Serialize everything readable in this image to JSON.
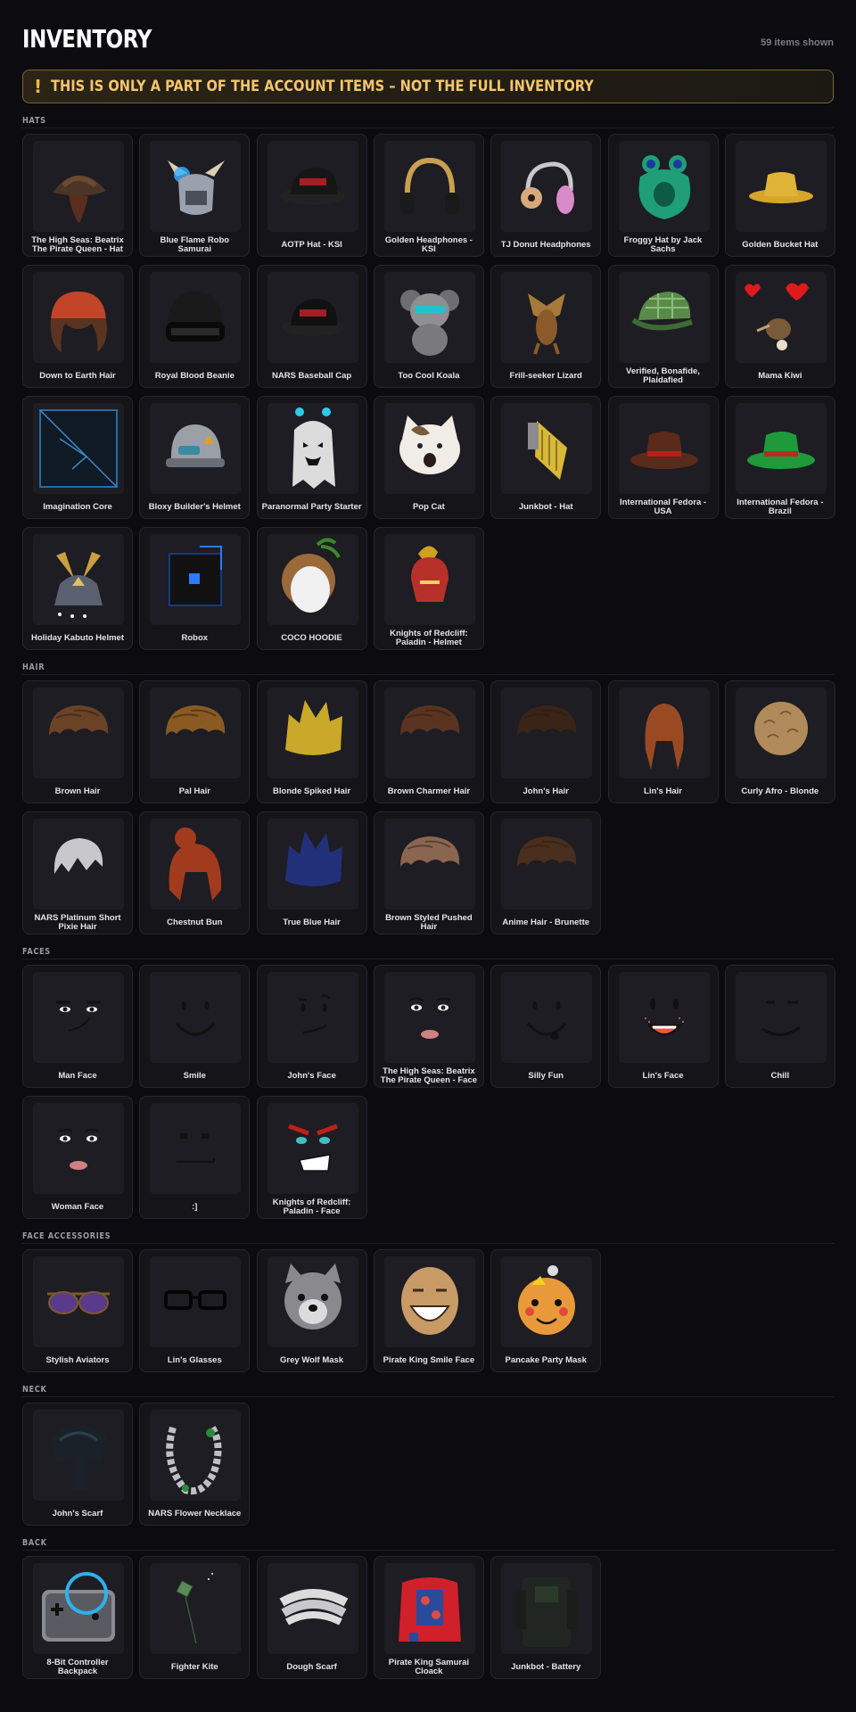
{
  "header": {
    "title": "INVENTORY",
    "items_count": "59 items shown"
  },
  "banner": {
    "icon": "!",
    "text": "THIS IS ONLY A PART OF THE ACCOUNT ITEMS – NOT THE FULL INVENTORY"
  },
  "sections": [
    {
      "label": "HATS",
      "items": [
        {
          "name": "The High Seas: Beatrix The Pirate Queen - Hat",
          "icon": "pirate-hat",
          "color": "#4a3526"
        },
        {
          "name": "Blue Flame Robo Samurai",
          "icon": "samurai-helmet",
          "color": "#9aa0ad"
        },
        {
          "name": "AOTP Hat - KSI",
          "icon": "cap",
          "color": "#161616"
        },
        {
          "name": "Golden Headphones - KSI",
          "icon": "headphones",
          "color": "#c8a050"
        },
        {
          "name": "TJ Donut Headphones",
          "icon": "donut-headphones",
          "color": "#d98ac8"
        },
        {
          "name": "Froggy Hat by Jack Sachs",
          "icon": "frog-hat",
          "color": "#1f9e77"
        },
        {
          "name": "Golden Bucket Hat",
          "icon": "bucket-hat",
          "color": "#d6a52a"
        },
        {
          "name": "Down to Earth Hair",
          "icon": "beanie-hair",
          "color": "#c2452a"
        },
        {
          "name": "Royal Blood Beanie",
          "icon": "beanie",
          "color": "#1a1a1a"
        },
        {
          "name": "NARS Baseball Cap",
          "icon": "cap",
          "color": "#111111"
        },
        {
          "name": "Too Cool Koala",
          "icon": "koala",
          "color": "#8f8f92"
        },
        {
          "name": "Frill-seeker Lizard",
          "icon": "lizard",
          "color": "#8a5a2b"
        },
        {
          "name": "Verified, Bonafide, Plaidafied",
          "icon": "plaid-cap",
          "color": "#5a8a4a"
        },
        {
          "name": "Mama Kiwi",
          "icon": "kiwi",
          "color": "#7a5a3a"
        },
        {
          "name": "Imagination Core",
          "icon": "cube",
          "color": "#0f1a24"
        },
        {
          "name": "Bloxy Builder's Helmet",
          "icon": "builder-helmet",
          "color": "#9aa0a6"
        },
        {
          "name": "Paranormal Party Starter",
          "icon": "ghost",
          "color": "#dcdcdc"
        },
        {
          "name": "Pop Cat",
          "icon": "cat",
          "color": "#f0ece6"
        },
        {
          "name": "Junkbot - Hat",
          "icon": "junkbot-hat",
          "color": "#d8b838"
        },
        {
          "name": "International Fedora - USA",
          "icon": "fedora",
          "color": "#5a2a1a"
        },
        {
          "name": "International Fedora - Brazil",
          "icon": "fedora",
          "color": "#1e9a3a"
        },
        {
          "name": "Holiday Kabuto Helmet",
          "icon": "kabuto",
          "color": "#c8a040"
        },
        {
          "name": "Robox",
          "icon": "robox",
          "color": "#111111"
        },
        {
          "name": "COCO HOODIE",
          "icon": "coconut",
          "color": "#9a6a3a"
        },
        {
          "name": "Knights of Redcliff: Paladin - Helmet",
          "icon": "paladin-helmet",
          "color": "#b8302a"
        }
      ]
    },
    {
      "label": "HAIR",
      "items": [
        {
          "name": "Brown Hair",
          "icon": "hair",
          "color": "#6a4226"
        },
        {
          "name": "Pal Hair",
          "icon": "hair",
          "color": "#8a5a22"
        },
        {
          "name": "Blonde Spiked Hair",
          "icon": "spiked-hair",
          "color": "#c9a82a"
        },
        {
          "name": "Brown Charmer Hair",
          "icon": "hair",
          "color": "#5a3420"
        },
        {
          "name": "John's Hair",
          "icon": "hair",
          "color": "#3a2418"
        },
        {
          "name": "Lin's Hair",
          "icon": "long-hair",
          "color": "#9a4a22"
        },
        {
          "name": "Curly Afro - Blonde",
          "icon": "afro",
          "color": "#b08a5a"
        },
        {
          "name": "NARS Platinum Short Pixie Hair",
          "icon": "pixie-hair",
          "color": "#c8c8cc"
        },
        {
          "name": "Chestnut Bun",
          "icon": "bun-hair",
          "color": "#a23a1e"
        },
        {
          "name": "True Blue Hair",
          "icon": "spiked-hair",
          "color": "#22307a"
        },
        {
          "name": "Brown Styled Pushed Hair",
          "icon": "hair",
          "color": "#8a6650"
        },
        {
          "name": "Anime Hair - Brunette",
          "icon": "hair",
          "color": "#4a2e1e"
        }
      ]
    },
    {
      "label": "FACES",
      "items": [
        {
          "name": "Man Face",
          "icon": "face-man",
          "color": "#111111"
        },
        {
          "name": "Smile",
          "icon": "face-smile",
          "color": "#111111"
        },
        {
          "name": "John's Face",
          "icon": "face-smirk",
          "color": "#111111"
        },
        {
          "name": "The High Seas: Beatrix The Pirate Queen - Face",
          "icon": "face-woman",
          "color": "#111111"
        },
        {
          "name": "Silly Fun",
          "icon": "face-silly",
          "color": "#111111"
        },
        {
          "name": "Lin's Face",
          "icon": "face-freckles",
          "color": "#111111"
        },
        {
          "name": "Chill",
          "icon": "face-chill",
          "color": "#111111"
        },
        {
          "name": "Woman Face",
          "icon": "face-woman",
          "color": "#111111"
        },
        {
          "name": ":]",
          "icon": "face-blocky",
          "color": "#111111"
        },
        {
          "name": "Knights of Redcliff: Paladin - Face",
          "icon": "face-paladin",
          "color": "#111111"
        }
      ]
    },
    {
      "label": "FACE ACCESSORIES",
      "items": [
        {
          "name": "Stylish Aviators",
          "icon": "aviators",
          "color": "#7a5a2a"
        },
        {
          "name": "Lin's Glasses",
          "icon": "glasses",
          "color": "#111111"
        },
        {
          "name": "Grey Wolf Mask",
          "icon": "wolf-mask",
          "color": "#8a8a8e"
        },
        {
          "name": "Pirate King Smile Face",
          "icon": "smile-mask",
          "color": "#c89a66"
        },
        {
          "name": "Pancake Party Mask",
          "icon": "pancake-mask",
          "color": "#e89a3a"
        }
      ]
    },
    {
      "label": "NECK",
      "items": [
        {
          "name": "John's Scarf",
          "icon": "scarf",
          "color": "#1a2228"
        },
        {
          "name": "NARS Flower Necklace",
          "icon": "necklace",
          "color": "#c0c0c4"
        }
      ]
    },
    {
      "label": "BACK",
      "items": [
        {
          "name": "8-Bit Controller Backpack",
          "icon": "controller-backpack",
          "color": "#8a8a92"
        },
        {
          "name": "Fighter Kite",
          "icon": "kite",
          "color": "#5a8a5a"
        },
        {
          "name": "Dough Scarf",
          "icon": "dough-scarf",
          "color": "#dcdcdc"
        },
        {
          "name": "Pirate King Samurai Cloack",
          "icon": "cloak",
          "color": "#d0202a"
        },
        {
          "name": "Junkbot - Battery",
          "icon": "battery",
          "color": "#222622"
        }
      ]
    }
  ]
}
